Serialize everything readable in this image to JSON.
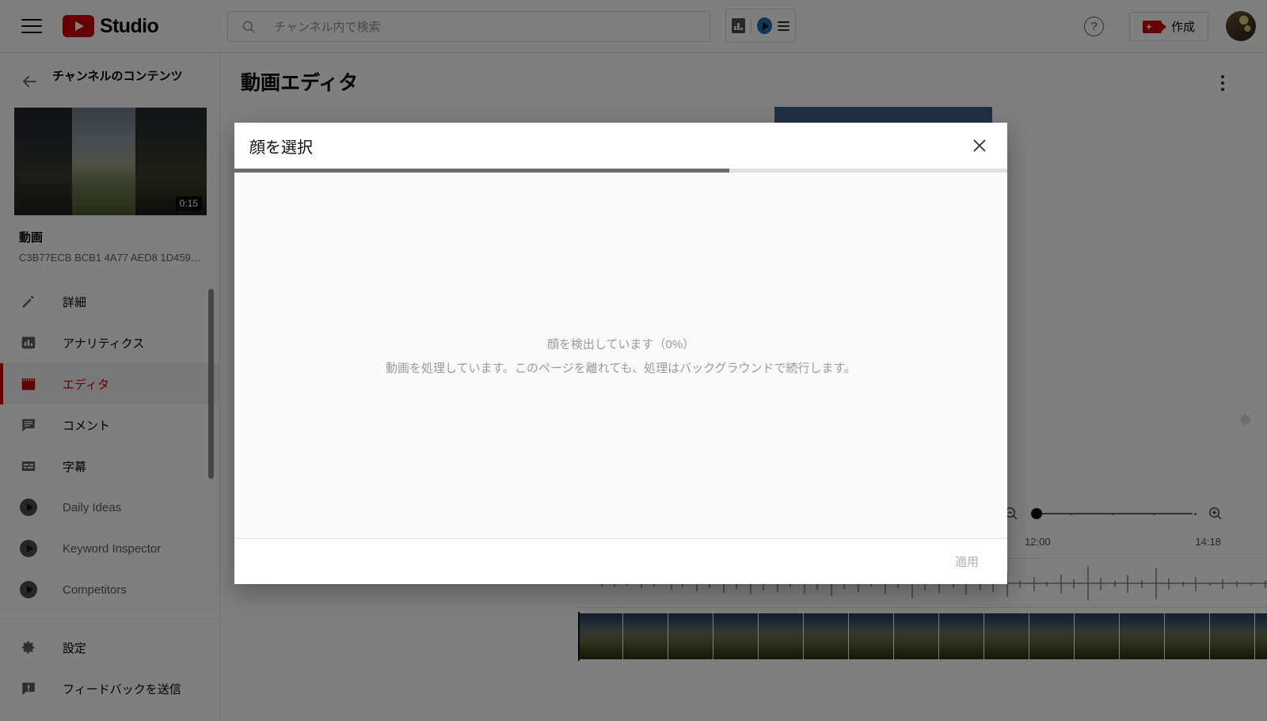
{
  "header": {
    "menu_icon": "hamburger-icon",
    "logo_text": "Studio",
    "search": {
      "placeholder": "チャンネル内で検索",
      "value": "",
      "icon": "search-icon"
    },
    "extension_toolbar": {
      "chart_icon": "bar-chart-icon",
      "play_icon": "play-badge-icon",
      "menu_icon": "hamburger-icon"
    },
    "help_label": "?",
    "create_label": "作成",
    "avatar": "user-avatar"
  },
  "sidebar": {
    "back_label": "back-arrow-icon",
    "title": "チャンネルのコンテンツ",
    "video": {
      "duration": "0:15",
      "title": "動画",
      "id": "C3B77ECB BCB1 4A77 AED8 1D459…"
    },
    "items": [
      {
        "label": "詳細",
        "icon": "pencil-icon",
        "active": false,
        "muted": false
      },
      {
        "label": "アナリティクス",
        "icon": "bar-chart-icon",
        "active": false,
        "muted": false
      },
      {
        "label": "エディタ",
        "icon": "clapperboard-icon",
        "active": true,
        "muted": false
      },
      {
        "label": "コメント",
        "icon": "comment-icon",
        "active": false,
        "muted": false
      },
      {
        "label": "字幕",
        "icon": "subtitles-icon",
        "active": false,
        "muted": false
      },
      {
        "label": "Daily Ideas",
        "icon": "extension-play-icon",
        "active": false,
        "muted": true
      },
      {
        "label": "Keyword Inspector",
        "icon": "extension-play-icon",
        "active": false,
        "muted": true
      },
      {
        "label": "Competitors",
        "icon": "extension-play-icon",
        "active": false,
        "muted": true
      }
    ],
    "footer_items": [
      {
        "label": "設定",
        "icon": "gear-icon"
      },
      {
        "label": "フィードバックを送信",
        "icon": "feedback-icon"
      }
    ]
  },
  "main": {
    "page_title": "動画エディタ",
    "overflow_icon": "kebab-menu-icon",
    "preview": {
      "settings_icon": "gear-icon"
    },
    "timeline": {
      "zoom_out_icon": "zoom-out-icon",
      "zoom_in_icon": "zoom-in-icon",
      "zoom_level": 0,
      "time_start": "12:00",
      "time_end": "14:18"
    }
  },
  "dialog": {
    "title": "顔を選択",
    "close_icon": "close-icon",
    "progress_percent": 64,
    "message_main": "顔を検出しています（0%）",
    "message_sub": "動画を処理しています。このページを離れても、処理はバックグラウンドで続行します。",
    "apply_label": "適用"
  },
  "colors": {
    "brand_red": "#cc0000",
    "active_red": "#c00000",
    "text_primary": "#030303",
    "text_secondary": "#606060",
    "scrim": "rgba(0,0,0,0.5)",
    "dialog_body": "#fafafa",
    "progress_fill": "#6b6b6b",
    "extension_blue": "#1f6fb2"
  }
}
